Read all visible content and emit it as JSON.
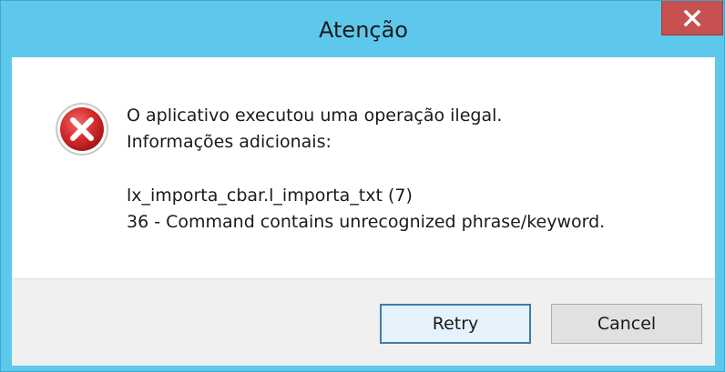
{
  "window": {
    "title": "Atenção",
    "close_icon": "close-x-icon",
    "colors": {
      "title_bar": "#5ec8ec",
      "close_button": "#c75050",
      "error_icon": "#d52b2b"
    }
  },
  "message": {
    "icon": "error-icon",
    "line1": "O aplicativo executou uma operação ilegal.",
    "line2": "Informações adicionais:",
    "line3": "lx_importa_cbar.l_importa_txt (7)",
    "line4": "36 - Command contains unrecognized phrase/keyword."
  },
  "buttons": {
    "retry_label": "Retry",
    "cancel_label": "Cancel"
  }
}
